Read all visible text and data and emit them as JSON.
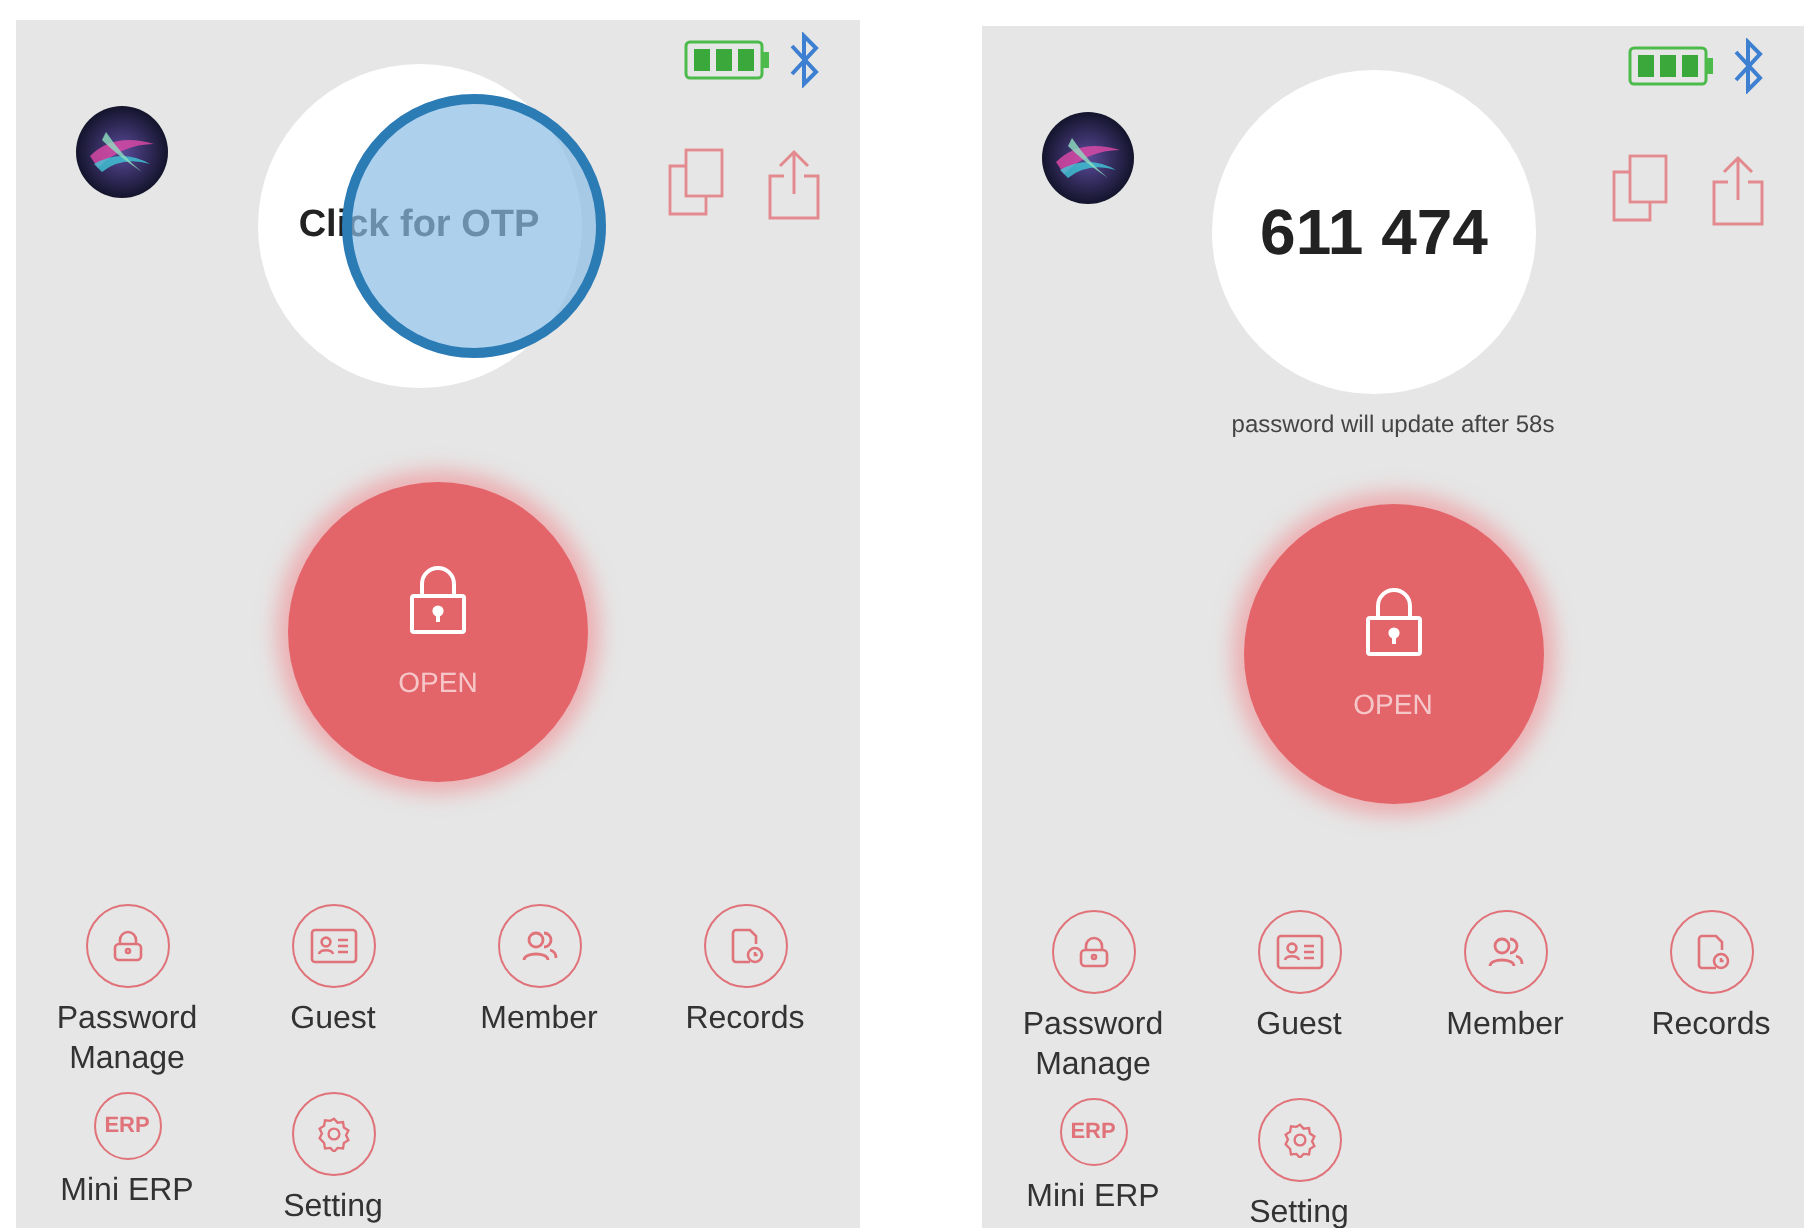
{
  "screens": [
    {
      "otp": {
        "kind": "prompt",
        "text": "Click for OTP"
      },
      "touch_indicator": true,
      "open_button": {
        "label": "OPEN"
      },
      "menu": [
        {
          "kind": "lock",
          "label": "Password Manage"
        },
        {
          "kind": "card",
          "label": "Guest"
        },
        {
          "kind": "people",
          "label": "Member"
        },
        {
          "kind": "records",
          "label": "Records"
        },
        {
          "kind": "erp",
          "label": "Mini ERP",
          "icon_text": "ERP"
        },
        {
          "kind": "gear",
          "label": "Setting"
        }
      ]
    },
    {
      "otp": {
        "kind": "code",
        "text": "611 474"
      },
      "touch_indicator": false,
      "caption": "password will update after 58s",
      "open_button": {
        "label": "OPEN"
      },
      "menu": [
        {
          "kind": "lock",
          "label": "Password Manage"
        },
        {
          "kind": "card",
          "label": "Guest"
        },
        {
          "kind": "people",
          "label": "Member"
        },
        {
          "kind": "records",
          "label": "Records"
        },
        {
          "kind": "erp",
          "label": "Mini ERP",
          "icon_text": "ERP"
        },
        {
          "kind": "gear",
          "label": "Setting"
        }
      ]
    }
  ]
}
